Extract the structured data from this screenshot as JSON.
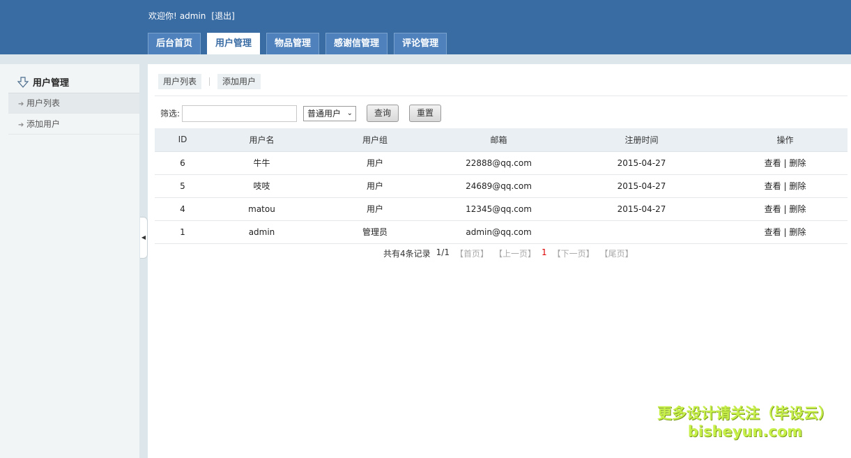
{
  "header": {
    "welcome_prefix": "欢迎你!",
    "username": "admin",
    "logout": "[退出]",
    "tabs": [
      "后台首页",
      "用户管理",
      "物品管理",
      "感谢信管理",
      "评论管理"
    ]
  },
  "sidebar": {
    "title": "用户管理",
    "items": [
      "用户列表",
      "添加用户"
    ]
  },
  "subnav": {
    "list": "用户列表",
    "add": "添加用户"
  },
  "filter": {
    "label": "筛选:",
    "input_value": "",
    "select_value": "普通用户",
    "query": "查询",
    "reset": "重置"
  },
  "table": {
    "headers": [
      "ID",
      "用户名",
      "用户组",
      "邮箱",
      "注册时间",
      "操作"
    ],
    "rows": [
      {
        "id": "6",
        "name": "牛牛",
        "group": "用户",
        "email": "22888@qq.com",
        "time": "2015-04-27",
        "view": "查看",
        "sep": "|",
        "del": "删除"
      },
      {
        "id": "5",
        "name": "吱吱",
        "group": "用户",
        "email": "24689@qq.com",
        "time": "2015-04-27",
        "view": "查看",
        "sep": "|",
        "del": "删除"
      },
      {
        "id": "4",
        "name": "matou",
        "group": "用户",
        "email": "12345@qq.com",
        "time": "2015-04-27",
        "view": "查看",
        "sep": "|",
        "del": "删除"
      },
      {
        "id": "1",
        "name": "admin",
        "group": "管理员",
        "email": "admin@qq.com",
        "time": "",
        "view": "查看",
        "sep": "|",
        "del": "删除"
      }
    ]
  },
  "pager": {
    "total": "共有4条记录",
    "pages": "1/1",
    "first": "【首页】",
    "prev": "【上一页】",
    "current": "1",
    "next": "【下一页】",
    "last": "【尾页】"
  },
  "watermark": {
    "line1": "更多设计请关注（毕设云）",
    "line2": "bisheyun.com"
  }
}
